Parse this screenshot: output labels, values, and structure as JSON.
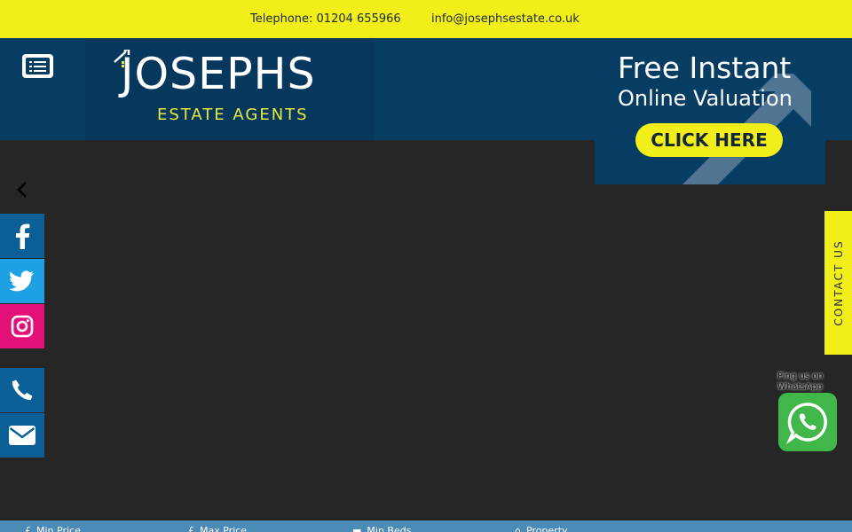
{
  "topbar": {
    "telephone": "Telephone: 01204 655966",
    "email": "info@josephsestate.co.uk"
  },
  "header": {
    "menu_icon": "menu-list-icon",
    "logo": {
      "brand": "JOSEPHS",
      "tagline": "ESTATE AGENTS"
    }
  },
  "promo": {
    "line1": "Free Instant",
    "line2": "Online Valuation",
    "cta": "CLICK HERE"
  },
  "slider": {
    "prev_icon": "chevron-left-icon"
  },
  "social": {
    "facebook_icon": "facebook-icon",
    "twitter_icon": "twitter-icon",
    "instagram_icon": "instagram-icon",
    "phone_icon": "phone-icon",
    "email_icon": "envelope-icon"
  },
  "contact_tab": {
    "label": "CONTACT US"
  },
  "whatsapp": {
    "label": "Ping us on WhatsApp",
    "icon": "whatsapp-icon"
  },
  "search": {
    "min_price": "Min Price",
    "max_price": "Max Price",
    "min_beds": "Min Beds",
    "property": "Property"
  },
  "colors": {
    "accent_yellow": "#f2ee1a",
    "header_navy": "#073c63",
    "facebook": "#0a5f97",
    "twitter": "#1ea0e4",
    "instagram": "#e4107a",
    "whatsapp": "#41b649",
    "searchbar": "#4b8bb7"
  }
}
